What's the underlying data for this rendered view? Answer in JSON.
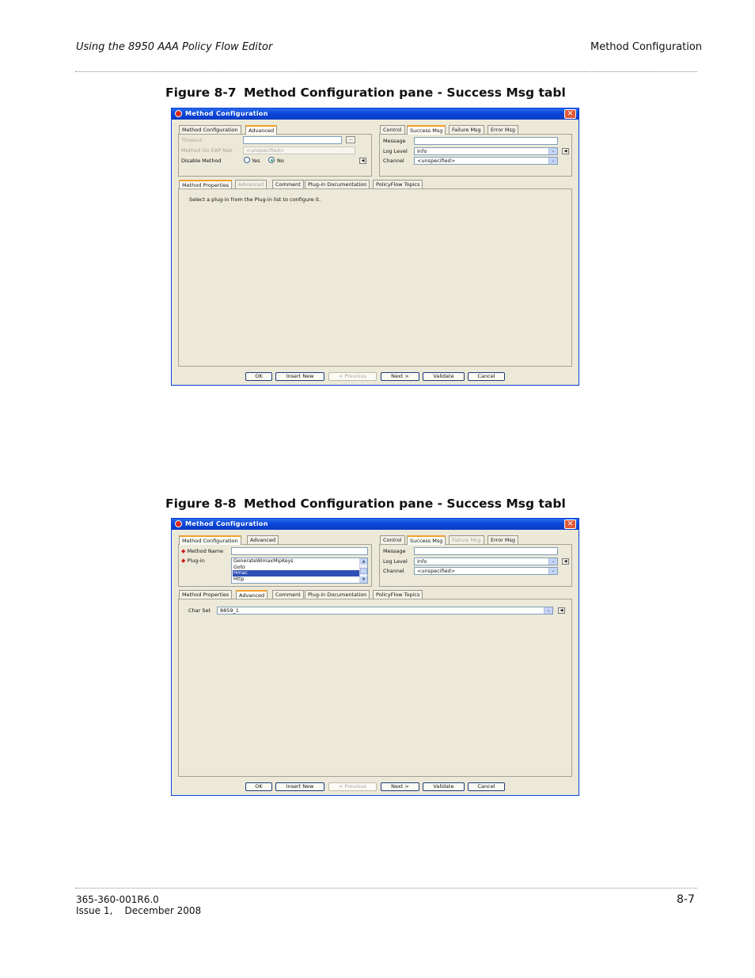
{
  "header": {
    "left": "Using the 8950 AAA Policy Flow Editor",
    "right": "Method Configuration"
  },
  "figures": [
    {
      "caption_num": "Figure 8-7",
      "caption_title": "Method Configuration pane - Success Msg tabl",
      "dialog": {
        "title": "Method Configuration",
        "left_tabs": [
          "Method Configuration",
          "Advanced"
        ],
        "left_fields": {
          "timeout_label": "Timeout",
          "timeout_value": "",
          "timeout_button": "...",
          "eap_nak_label": "Method On EAP Nak",
          "eap_nak_value": "<unspecified>",
          "disable_label": "Disable Method",
          "radio_yes": "Yes",
          "radio_no": "No"
        },
        "right_tabs": [
          "Control",
          "Success Msg",
          "Failure Msg",
          "Error Msg"
        ],
        "right_fields": {
          "message_label": "Message",
          "message_value": "",
          "log_level_label": "Log Level",
          "log_level_value": "Info",
          "channel_label": "Channel",
          "channel_value": "<unspecified>"
        },
        "bottom_tabs": [
          "Method Properties",
          "Advanced",
          "Comment",
          "Plug-in Documentation",
          "PolicyFlow Topics"
        ],
        "content_text": "Select a plug-in from the Plug-in list to configure it.",
        "buttons": [
          "OK",
          "Insert New",
          "< Previous",
          "Next >",
          "Validate",
          "Cancel"
        ]
      }
    },
    {
      "caption_num": "Figure 8-8",
      "caption_title": "Method Configuration pane - Success Msg tabl",
      "dialog": {
        "title": "Method Configuration",
        "left_tabs": [
          "Method Configuration",
          "Advanced"
        ],
        "left_fields": {
          "method_name_label": "Method Name",
          "method_name_value": "",
          "plugin_label": "Plug-in",
          "plugin_options": [
            "GenerateWimaxMipKeys",
            "Goto",
            "Hmac",
            "Http"
          ],
          "plugin_selected": "Hmac"
        },
        "right_tabs": [
          "Control",
          "Success Msg",
          "Failure Msg",
          "Error Msg"
        ],
        "right_fields": {
          "message_label": "Message",
          "message_value": "",
          "log_level_label": "Log Level",
          "log_level_value": "Info",
          "channel_label": "Channel",
          "channel_value": "<unspecified>"
        },
        "bottom_tabs": [
          "Method Properties",
          "Advanced",
          "Comment",
          "Plug-in Documentation",
          "PolicyFlow Topics"
        ],
        "charset_label": "Char Set",
        "charset_value": "8859_1",
        "buttons": [
          "OK",
          "Insert New",
          "< Previous",
          "Next >",
          "Validate",
          "Cancel"
        ]
      }
    }
  ],
  "footer": {
    "doc_number": "365-360-001R6.0",
    "issue": "Issue 1,    December 2008",
    "page": "8-7"
  }
}
